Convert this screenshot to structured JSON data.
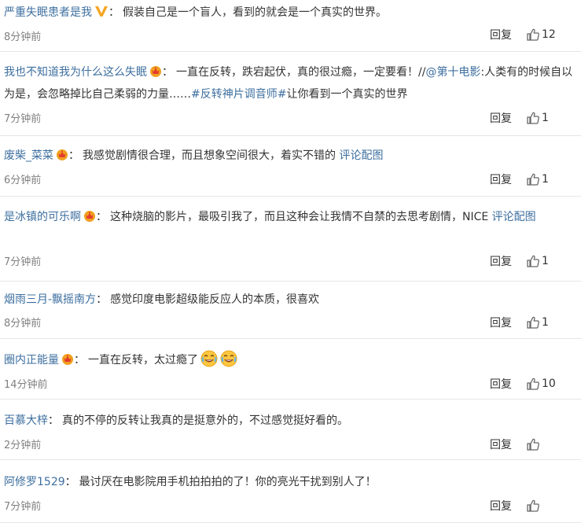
{
  "comments": [
    {
      "user": "严重失眠患者是我",
      "badge": "vip-v-icon",
      "colon": "：",
      "text": "假装自己是一个盲人，看到的就会是一个真实的世界。",
      "time": "8分钟前",
      "reply": "回复",
      "likes": "12"
    },
    {
      "user": "我也不知道我为什么这么失眠",
      "badge": "crown-icon",
      "colon": "：",
      "text": "一直在反转，跌宕起伏，真的很过瘾，一定要看！//",
      "mention": "@第十电影",
      "text2": ":人类有的时候自以为是，会忽略掉比自己柔弱的力量……",
      "hashtag": "#反转神片调音师#",
      "text3": "让你看到一个真实的世界",
      "time": "7分钟前",
      "reply": "回复",
      "likes": "1"
    },
    {
      "user": "废柴_菜菜",
      "badge": "crown-icon",
      "colon": "：",
      "text": "我感觉剧情很合理，而且想象空间很大，着实不错的 ",
      "link": "评论配图",
      "time": "6分钟前",
      "reply": "回复",
      "likes": "1"
    },
    {
      "user": "是冰镇的可乐啊",
      "badge": "crown-icon",
      "colon": "：",
      "text": "这种烧脑的影片，最吸引我了，而且这种会让我情不自禁的去思考剧情，NICE ",
      "link": "评论配图",
      "time": "7分钟前",
      "reply": "回复",
      "likes": "1"
    },
    {
      "user": "烟雨三月-飘摇南方",
      "colon": "：",
      "text": "感觉印度电影超级能反应人的本质，很喜欢",
      "time": "8分钟前",
      "reply": "回复",
      "likes": "1"
    },
    {
      "user": "圈内正能量",
      "badge": "crown-icon",
      "colon": "：",
      "text": "一直在反转，太过瘾了",
      "emoji": [
        "laugh-cry-emoji",
        "laugh-cry-emoji"
      ],
      "time": "14分钟前",
      "reply": "回复",
      "likes": "10"
    },
    {
      "user": "百慕大梓",
      "colon": "：",
      "text": "真的不停的反转让我真的是挺意外的，不过感觉挺好看的。",
      "time": "2分钟前",
      "reply": "回复",
      "likes": ""
    },
    {
      "user": "阿修罗1529",
      "colon": "：",
      "text": "最讨厌在电影院用手机拍拍拍的了！你的亮光干扰到别人了！",
      "time": "7分钟前",
      "reply": "回复",
      "likes": ""
    }
  ]
}
